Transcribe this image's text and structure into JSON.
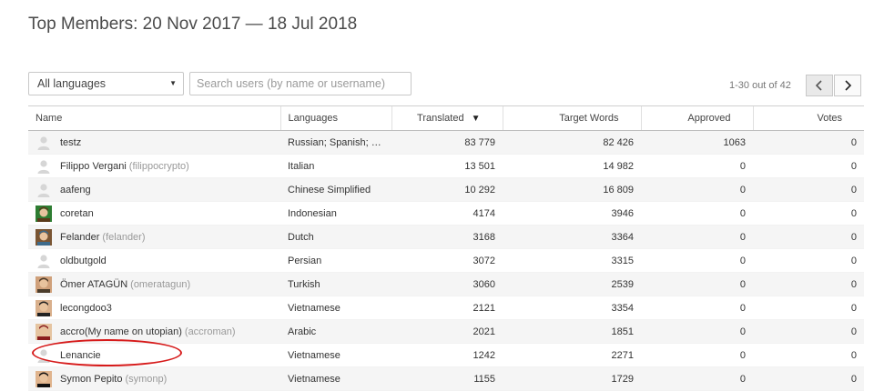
{
  "page": {
    "title": "Top Members: 20 Nov 2017 — 18 Jul 2018"
  },
  "filters": {
    "language_selected": "All languages",
    "search_placeholder": "Search users (by name or username)"
  },
  "pager": {
    "text": "1-30 out of 42",
    "prev_icon": "chevron-left-icon",
    "next_icon": "chevron-right-icon"
  },
  "table": {
    "columns": {
      "name": "Name",
      "languages": "Languages",
      "translated": "Translated",
      "target_words": "Target Words",
      "approved": "Approved",
      "votes": "Votes"
    },
    "sort_indicator": "▼",
    "rows": [
      {
        "name": "testz",
        "handle": "",
        "avatar": "default-avatar",
        "languages": "Russian; Spanish; Bu...",
        "translated": "83 779",
        "target_words": "82 426",
        "approved": "1063",
        "votes": "0"
      },
      {
        "name": "Filippo Vergani",
        "handle": "(filippocrypto)",
        "avatar": "default-avatar",
        "languages": "Italian",
        "translated": "13 501",
        "target_words": "14 982",
        "approved": "0",
        "votes": "0"
      },
      {
        "name": "aafeng",
        "handle": "",
        "avatar": "default-avatar",
        "languages": "Chinese Simplified",
        "translated": "10 292",
        "target_words": "16 809",
        "approved": "0",
        "votes": "0"
      },
      {
        "name": "coretan",
        "handle": "",
        "avatar": "photo-avatar",
        "languages": "Indonesian",
        "translated": "4174",
        "target_words": "3946",
        "approved": "0",
        "votes": "0"
      },
      {
        "name": "Felander",
        "handle": "(felander)",
        "avatar": "photo-avatar",
        "languages": "Dutch",
        "translated": "3168",
        "target_words": "3364",
        "approved": "0",
        "votes": "0"
      },
      {
        "name": "oldbutgold",
        "handle": "",
        "avatar": "default-avatar",
        "languages": "Persian",
        "translated": "3072",
        "target_words": "3315",
        "approved": "0",
        "votes": "0"
      },
      {
        "name": "Ömer ATAGÜN",
        "handle": "(omeratagun)",
        "avatar": "photo-avatar",
        "languages": "Turkish",
        "translated": "3060",
        "target_words": "2539",
        "approved": "0",
        "votes": "0"
      },
      {
        "name": "lecongdoo3",
        "handle": "",
        "avatar": "photo-avatar",
        "languages": "Vietnamese",
        "translated": "2121",
        "target_words": "3354",
        "approved": "0",
        "votes": "0"
      },
      {
        "name": "accro(My name on utopian)",
        "handle": "(accroman)",
        "avatar": "photo-avatar",
        "languages": "Arabic",
        "translated": "2021",
        "target_words": "1851",
        "approved": "0",
        "votes": "0"
      },
      {
        "name": "Lenancie",
        "handle": "",
        "avatar": "default-avatar",
        "languages": "Vietnamese",
        "translated": "1242",
        "target_words": "2271",
        "approved": "0",
        "votes": "0"
      },
      {
        "name": "Symon Pepito",
        "handle": "(symonp)",
        "avatar": "photo-avatar",
        "languages": "Vietnamese",
        "translated": "1155",
        "target_words": "1729",
        "approved": "0",
        "votes": "0"
      }
    ]
  },
  "colors": {
    "highlight": "#d61a1a",
    "row_stripe": "#f5f5f5"
  }
}
